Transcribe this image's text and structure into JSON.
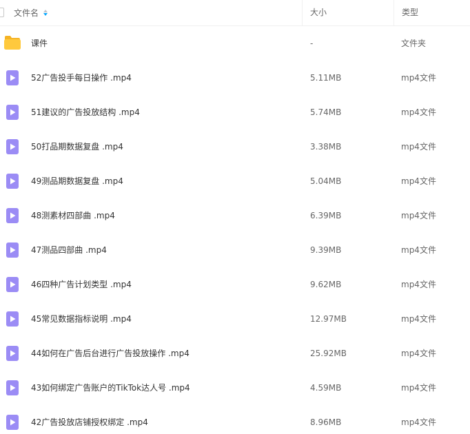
{
  "header": {
    "name_label": "文件名",
    "size_label": "大小",
    "type_label": "类型"
  },
  "colors": {
    "accent": "#06a7ff",
    "video_icon": "#9b8cf5",
    "folder_icon": "#ffc93d"
  },
  "files": [
    {
      "name": "课件",
      "size": "-",
      "type": "文件夹",
      "icon": "folder-icon"
    },
    {
      "name": "52广告投手每日操作 .mp4",
      "size": "5.11MB",
      "type": "mp4文件",
      "icon": "video-icon"
    },
    {
      "name": "51建议的广告投放结构 .mp4",
      "size": "5.74MB",
      "type": "mp4文件",
      "icon": "video-icon"
    },
    {
      "name": "50打品期数据复盘 .mp4",
      "size": "3.38MB",
      "type": "mp4文件",
      "icon": "video-icon"
    },
    {
      "name": "49测品期数据复盘 .mp4",
      "size": "5.04MB",
      "type": "mp4文件",
      "icon": "video-icon"
    },
    {
      "name": "48测素材四部曲 .mp4",
      "size": "6.39MB",
      "type": "mp4文件",
      "icon": "video-icon"
    },
    {
      "name": "47测品四部曲 .mp4",
      "size": "9.39MB",
      "type": "mp4文件",
      "icon": "video-icon"
    },
    {
      "name": "46四种广告计划类型 .mp4",
      "size": "9.62MB",
      "type": "mp4文件",
      "icon": "video-icon"
    },
    {
      "name": "45常见数据指标说明 .mp4",
      "size": "12.97MB",
      "type": "mp4文件",
      "icon": "video-icon"
    },
    {
      "name": "44如何在广告后台进行广告投放操作 .mp4",
      "size": "25.92MB",
      "type": "mp4文件",
      "icon": "video-icon"
    },
    {
      "name": "43如何绑定广告账户的TikTok达人号 .mp4",
      "size": "4.59MB",
      "type": "mp4文件",
      "icon": "video-icon"
    },
    {
      "name": "42广告投放店铺授权绑定 .mp4",
      "size": "8.96MB",
      "type": "mp4文件",
      "icon": "video-icon"
    }
  ]
}
